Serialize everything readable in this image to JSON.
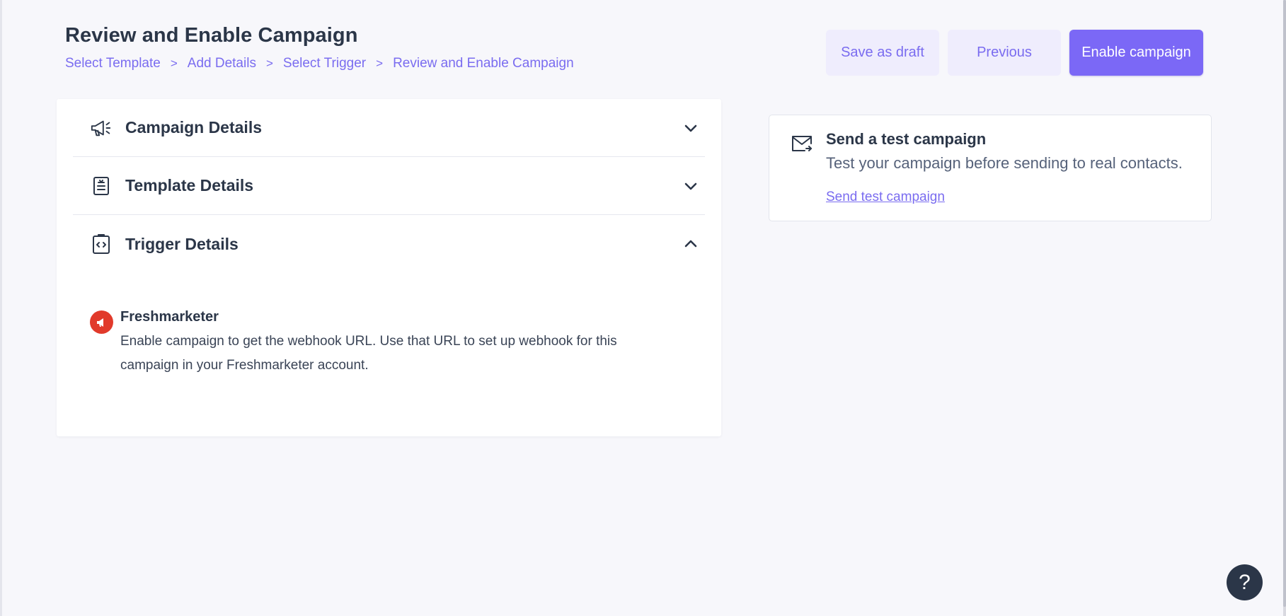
{
  "header": {
    "title": "Review and Enable Campaign",
    "breadcrumb": [
      "Select Template",
      "Add Details",
      "Select Trigger",
      "Review and Enable Campaign"
    ],
    "separator": ">"
  },
  "actions": {
    "save_draft": "Save as draft",
    "previous": "Previous",
    "enable": "Enable campaign"
  },
  "accordion": {
    "campaign_details": {
      "label": "Campaign Details",
      "icon": "megaphone-icon",
      "expanded": false
    },
    "template_details": {
      "label": "Template Details",
      "icon": "document-icon",
      "expanded": false
    },
    "trigger_details": {
      "label": "Trigger Details",
      "icon": "code-clipboard-icon",
      "expanded": true
    }
  },
  "trigger": {
    "name": "Freshmarketer",
    "description": "Enable campaign to get the webhook URL. Use that URL to set up webhook for this campaign in your Freshmarketer account."
  },
  "test_campaign": {
    "title": "Send a test campaign",
    "description": "Test your campaign before sending to real contacts.",
    "link": "Send test campaign"
  },
  "help": {
    "label": "?"
  },
  "colors": {
    "accent": "#7b68f6",
    "accent_light": "#efedfd",
    "text_dark": "#2b3648",
    "freshmarketer_red": "#e13a2b"
  }
}
